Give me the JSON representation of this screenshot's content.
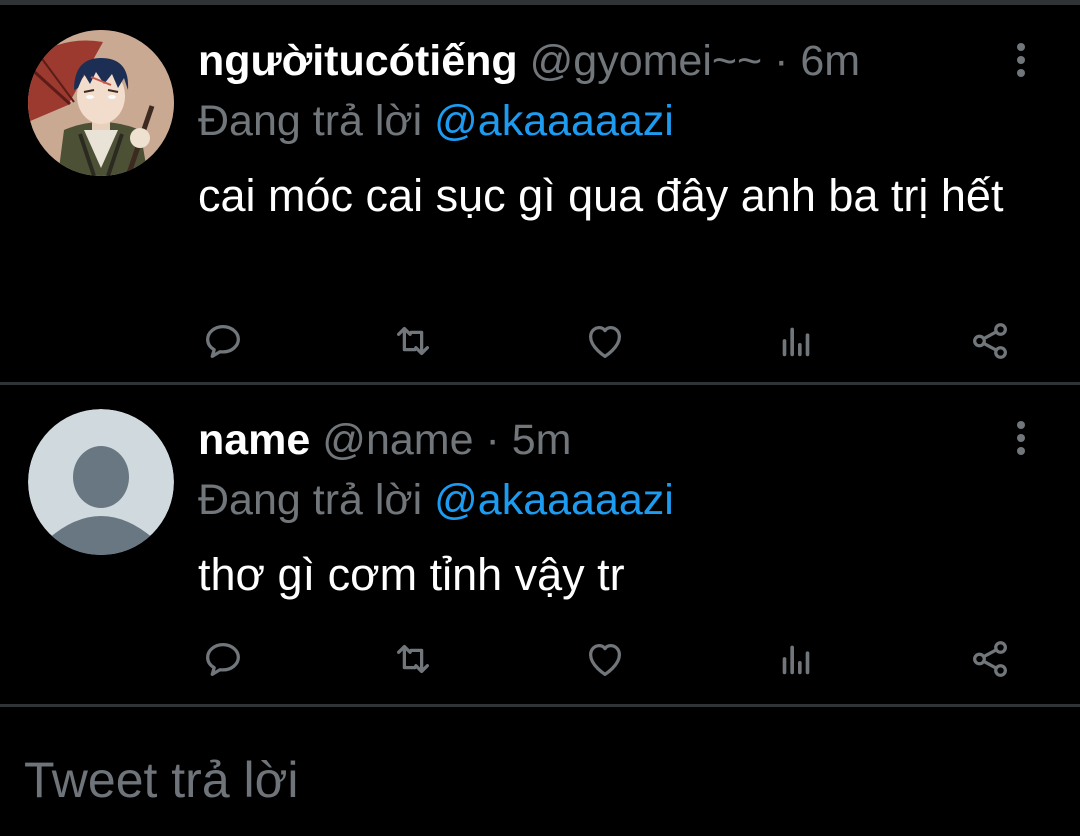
{
  "tweets": [
    {
      "display_name": "ngườitucótiếng",
      "handle": "@gyomei~~",
      "separator": "·",
      "time": "6m",
      "reply_prefix": "Đang trả lời",
      "reply_to": "@akaaaaazi",
      "text": "cai móc cai sục gì qua đây anh ba trị hết",
      "avatar": "anime-character-avatar"
    },
    {
      "display_name": "name",
      "handle": "@name",
      "separator": "·",
      "time": "5m",
      "reply_prefix": "Đang trả lời",
      "reply_to": "@akaaaaazi",
      "text": "thơ gì cơm tỉnh vậy tr",
      "avatar": "default-avatar"
    }
  ],
  "action_icons": [
    "reply-icon",
    "retweet-icon",
    "like-icon",
    "views-icon",
    "share-icon"
  ],
  "reply_box": {
    "placeholder": "Tweet trả lời"
  },
  "colors": {
    "background": "#000000",
    "text_primary": "#ffffff",
    "text_secondary": "#71767b",
    "mention": "#1d9bf0",
    "divider": "#2f3336"
  }
}
